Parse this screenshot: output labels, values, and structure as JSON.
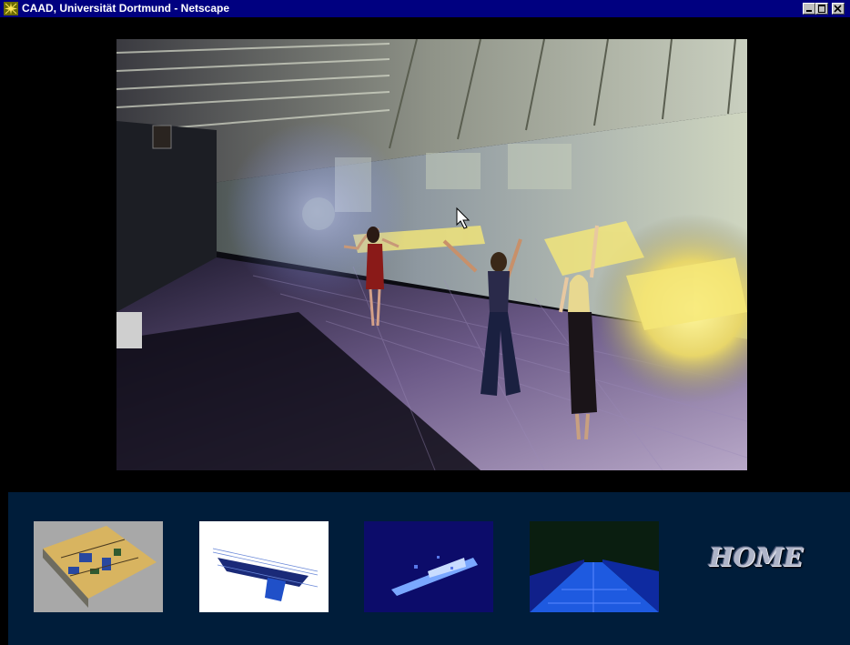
{
  "window": {
    "title": "CAAD, Universität Dortmund - Netscape",
    "app_icon": "netscape-icon",
    "controls": [
      "minimize",
      "maximize",
      "close"
    ]
  },
  "scene": {
    "description_icon": "dancers-in-3d-hall-render",
    "cursor": "arrow-cursor"
  },
  "nav": {
    "thumbnails": [
      {
        "icon": "building-model-thumbnail"
      },
      {
        "icon": "wireframe-structure-thumbnail"
      },
      {
        "icon": "blue-render-thumbnail"
      },
      {
        "icon": "corridor-perspective-thumbnail"
      }
    ],
    "home_label": "HOME"
  },
  "colors": {
    "titlebar": "#000080",
    "nav_background": "#001d3a",
    "page_background": "#000000"
  }
}
